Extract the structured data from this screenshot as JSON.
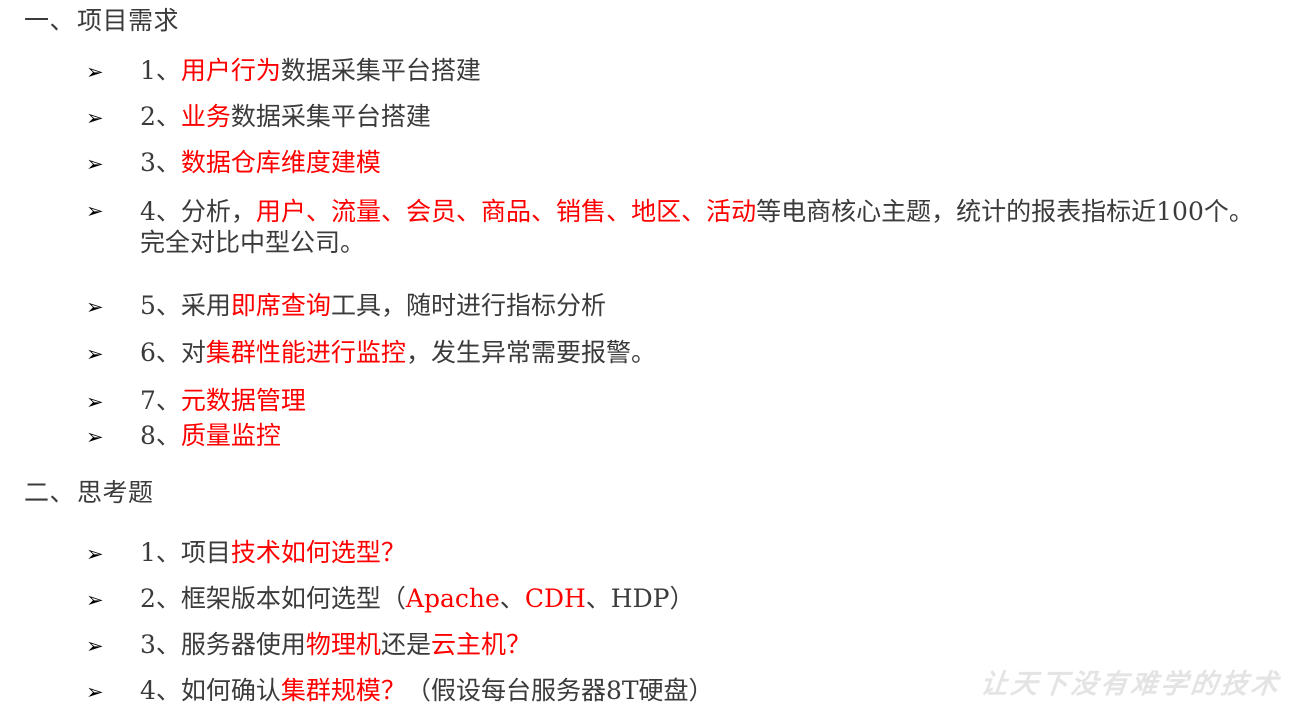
{
  "slide": {
    "background_color": "#ffffff",
    "text_color": "#3b3b3b",
    "accent_color": "#ff0000"
  },
  "sections": [
    {
      "number": "一、",
      "title": "项目需求"
    },
    {
      "number": "二、",
      "title": "思考题"
    }
  ],
  "requirements": [
    {
      "marker": "➢",
      "number": "1、",
      "parts": [
        {
          "text": "用户行为",
          "color": "red"
        },
        {
          "text": "数据采集平台搭建",
          "color": "dark"
        }
      ]
    },
    {
      "marker": "➢",
      "number": "2、",
      "parts": [
        {
          "text": "业务",
          "color": "red"
        },
        {
          "text": "数据采集平台搭建",
          "color": "dark"
        }
      ]
    },
    {
      "marker": "➢",
      "number": "3、",
      "parts": [
        {
          "text": "数据仓库维度建模",
          "color": "red"
        }
      ]
    },
    {
      "marker": "➢",
      "number": "4、",
      "parts": [
        {
          "text": "分析，",
          "color": "dark"
        },
        {
          "text": "用户",
          "color": "red"
        },
        {
          "text": "、",
          "color": "red"
        },
        {
          "text": "流量",
          "color": "red"
        },
        {
          "text": "、",
          "color": "red"
        },
        {
          "text": "会员",
          "color": "red"
        },
        {
          "text": "、",
          "color": "red"
        },
        {
          "text": "商品",
          "color": "red"
        },
        {
          "text": "、",
          "color": "red"
        },
        {
          "text": "销售",
          "color": "red"
        },
        {
          "text": "、",
          "color": "red"
        },
        {
          "text": "地区",
          "color": "red"
        },
        {
          "text": "、",
          "color": "red"
        },
        {
          "text": "活动",
          "color": "red"
        },
        {
          "text": "等电商核心主题，统计的报表指标近100个。完全对比中型公司。",
          "color": "dark"
        }
      ]
    },
    {
      "marker": "➢",
      "number": "5、",
      "parts": [
        {
          "text": "采用",
          "color": "dark"
        },
        {
          "text": "即席查询",
          "color": "red"
        },
        {
          "text": "工具，随时进行指标分析",
          "color": "dark"
        }
      ]
    },
    {
      "marker": "➢",
      "number": "6、",
      "parts": [
        {
          "text": "对",
          "color": "dark"
        },
        {
          "text": "集群性能进行监控",
          "color": "red"
        },
        {
          "text": "，发生异常需要报警。",
          "color": "dark"
        }
      ]
    },
    {
      "marker": "➢",
      "number": "7、",
      "parts": [
        {
          "text": "元数据管理",
          "color": "red"
        }
      ]
    },
    {
      "marker": "➢",
      "number": "8、",
      "parts": [
        {
          "text": "质量监控",
          "color": "red"
        }
      ]
    }
  ],
  "questions": [
    {
      "marker": "➢",
      "number": "1、",
      "parts": [
        {
          "text": "项目",
          "color": "dark"
        },
        {
          "text": "技术如何选型？",
          "color": "red"
        }
      ]
    },
    {
      "marker": "➢",
      "number": "2、",
      "parts": [
        {
          "text": "框架版本如何选型（",
          "color": "dark"
        },
        {
          "text": "Apache",
          "color": "red"
        },
        {
          "text": "、",
          "color": "dark"
        },
        {
          "text": "CDH",
          "color": "red"
        },
        {
          "text": "、HDP）",
          "color": "dark"
        }
      ]
    },
    {
      "marker": "➢",
      "number": "3、",
      "parts": [
        {
          "text": "服务器使用",
          "color": "dark"
        },
        {
          "text": "物理机",
          "color": "red"
        },
        {
          "text": "还是",
          "color": "dark"
        },
        {
          "text": "云主机？",
          "color": "red"
        }
      ]
    },
    {
      "marker": "➢",
      "number": "4、",
      "parts": [
        {
          "text": "如何确认",
          "color": "dark"
        },
        {
          "text": "集群规模？",
          "color": "red"
        },
        {
          "text": "（假设每台服务器8T硬盘）",
          "color": "dark"
        }
      ]
    }
  ],
  "watermark": {
    "text": "让天下没有难学的技术",
    "color": "#e4e4e4"
  }
}
